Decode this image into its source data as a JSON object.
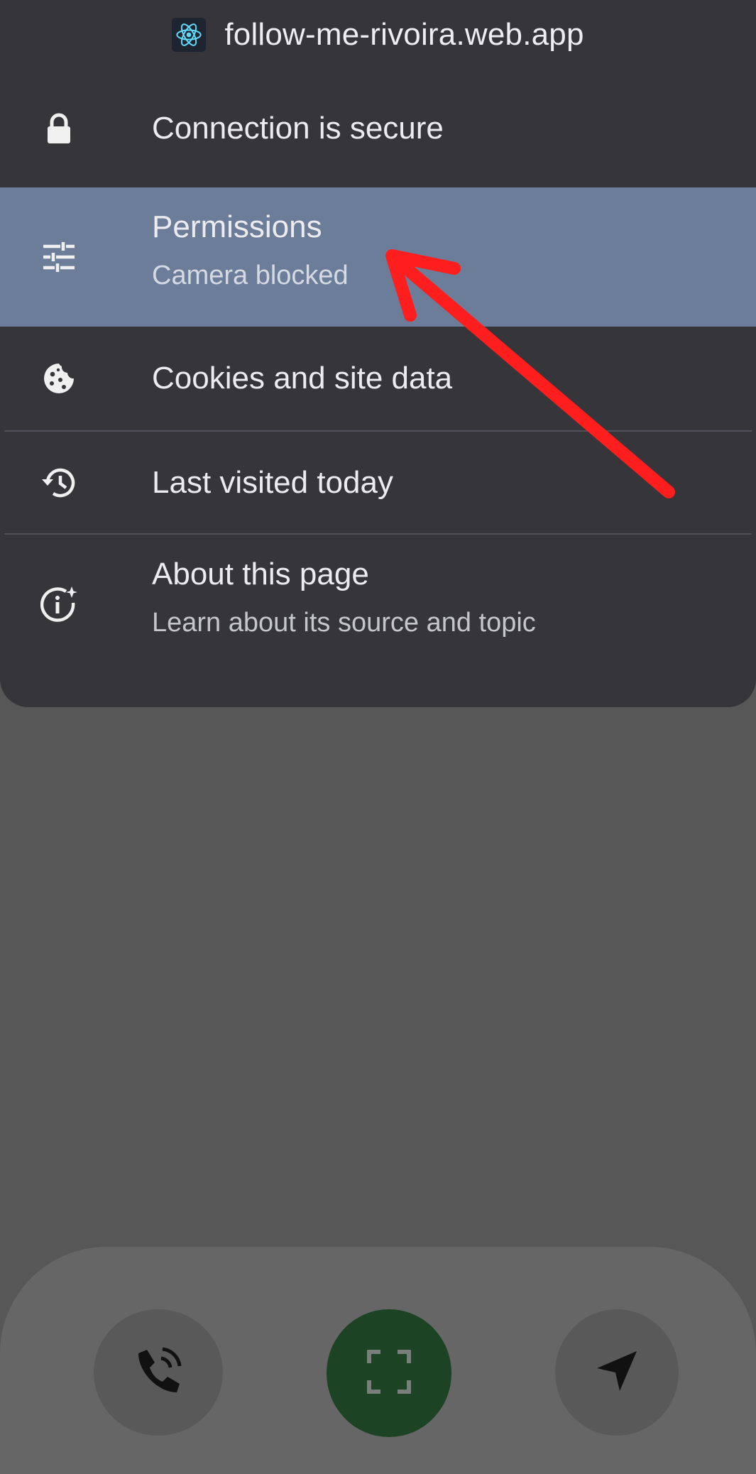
{
  "site": {
    "domain": "follow-me-rivoira.web.app",
    "favicon": "react-logo-icon"
  },
  "menu": {
    "items": [
      {
        "id": "connection",
        "icon": "lock-icon",
        "label": "Connection is secure"
      },
      {
        "id": "permissions",
        "icon": "tune-sliders-icon",
        "label": "Permissions",
        "subtitle": "Camera blocked",
        "highlighted": true
      },
      {
        "id": "cookies",
        "icon": "cookie-icon",
        "label": "Cookies and site data"
      },
      {
        "id": "history",
        "icon": "history-icon",
        "label": "Last visited today"
      },
      {
        "id": "about",
        "icon": "info-sparkle-icon",
        "label": "About this page",
        "subtitle": "Learn about its source and topic"
      }
    ]
  },
  "bottom_nav": {
    "buttons": [
      {
        "id": "call",
        "icon": "phone-call-icon"
      },
      {
        "id": "scan",
        "icon": "scan-frame-icon",
        "active": true
      },
      {
        "id": "navigate",
        "icon": "navigation-arrow-icon"
      }
    ]
  },
  "annotation": {
    "type": "red-arrow",
    "points_to": "permissions",
    "color": "#ff1e1e"
  },
  "colors": {
    "sheet_bg": "#35353a",
    "highlight_bg": "#6c7d99",
    "backdrop": "#575757",
    "active_button": "#1c4323",
    "react_blue": "#61dafb"
  }
}
